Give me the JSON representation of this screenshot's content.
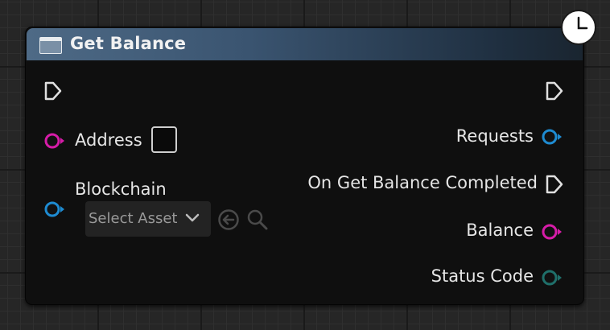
{
  "node": {
    "title": "Get Balance",
    "inputs": {
      "address_label": "Address",
      "blockchain_label": "Blockchain",
      "select_asset": "Select Asset"
    },
    "outputs": {
      "requests_label": "Requests",
      "completed_label": "On Get Balance Completed",
      "balance_label": "Balance",
      "status_code_label": "Status Code"
    },
    "colors": {
      "exec_pin": "#e0e0e0",
      "string_pin": "#d61ca8",
      "object_pin": "#1e8bd1",
      "int_pin": "#1f6f6a",
      "header_start": "#4e6a86",
      "header_end": "#1a2530"
    },
    "icons": [
      "node-function-icon",
      "latent-clock-icon",
      "exec-pin-icon",
      "data-pin-icon",
      "chevron-down-icon",
      "use-selected-arrow-icon",
      "browse-search-icon"
    ]
  }
}
